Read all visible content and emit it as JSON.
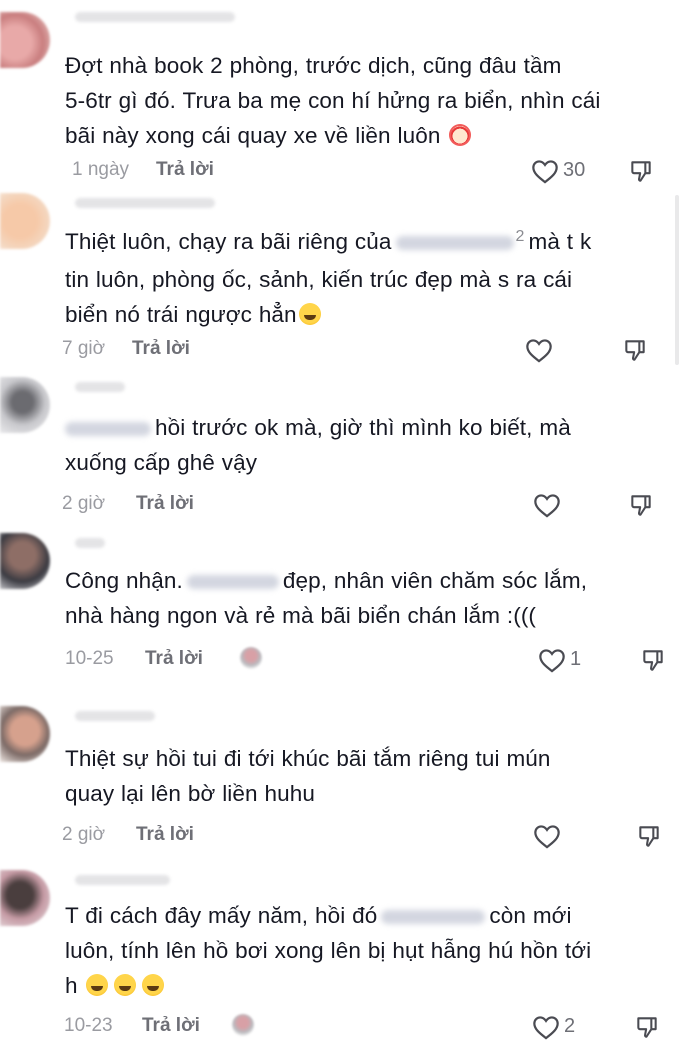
{
  "comments": [
    {
      "lines": [
        "Đợt nhà book 2 phòng, trước dịch, cũng đâu tầm",
        "5-6tr gì đó. Trưa ba mẹ con hí hửng ra biển, nhìn cái",
        "bãi này xong cái quay xe về liền luôn"
      ],
      "time": "1 ngày",
      "reply": "Trả lời",
      "likes": "30",
      "emoji": "clown-face-emoji"
    },
    {
      "lines": [
        "Thiệt luôn, chạy ra bãi riêng của",
        "mà t k",
        "tin luôn, phòng ốc, sảnh, kiến trúc đẹp mà s ra cái",
        "biển nó trái ngược hẳn"
      ],
      "superscript": "2",
      "time": "7 giờ",
      "reply": "Trả lời",
      "likes": "",
      "emoji": "grinning-sweat-emoji"
    },
    {
      "lines": [
        "hồi trước ok mà, giờ thì mình ko biết, mà",
        "xuống cấp ghê vậy"
      ],
      "time": "2 giờ",
      "reply": "Trả lời",
      "likes": ""
    },
    {
      "lines": [
        "Công nhận.",
        "đẹp, nhân viên chăm sóc lắm,",
        "nhà hàng ngon và rẻ mà bãi biển chán lắm :((("
      ],
      "time": "10-25",
      "reply": "Trả lời",
      "likes": "1"
    },
    {
      "lines": [
        "Thiệt sự hồi tui đi tới khúc bãi tắm riêng tui mún",
        "quay lại lên bờ liền huhu"
      ],
      "time": "2 giờ",
      "reply": "Trả lời",
      "likes": ""
    },
    {
      "lines": [
        "T đi cách đây mấy năm, hồi đó",
        "còn mới",
        "luôn, tính lên hồ bơi xong lên bị hụt hẫng hú hồn tới",
        "h"
      ],
      "time": "10-23",
      "reply": "Trả lời",
      "likes": "2",
      "emoji": "face-with-tears-of-joy-emoji"
    }
  ],
  "colors": {
    "text": "#161823",
    "meta": "#9a9ba1",
    "reply": "#6e6f76",
    "icon": "#4a4b52"
  }
}
